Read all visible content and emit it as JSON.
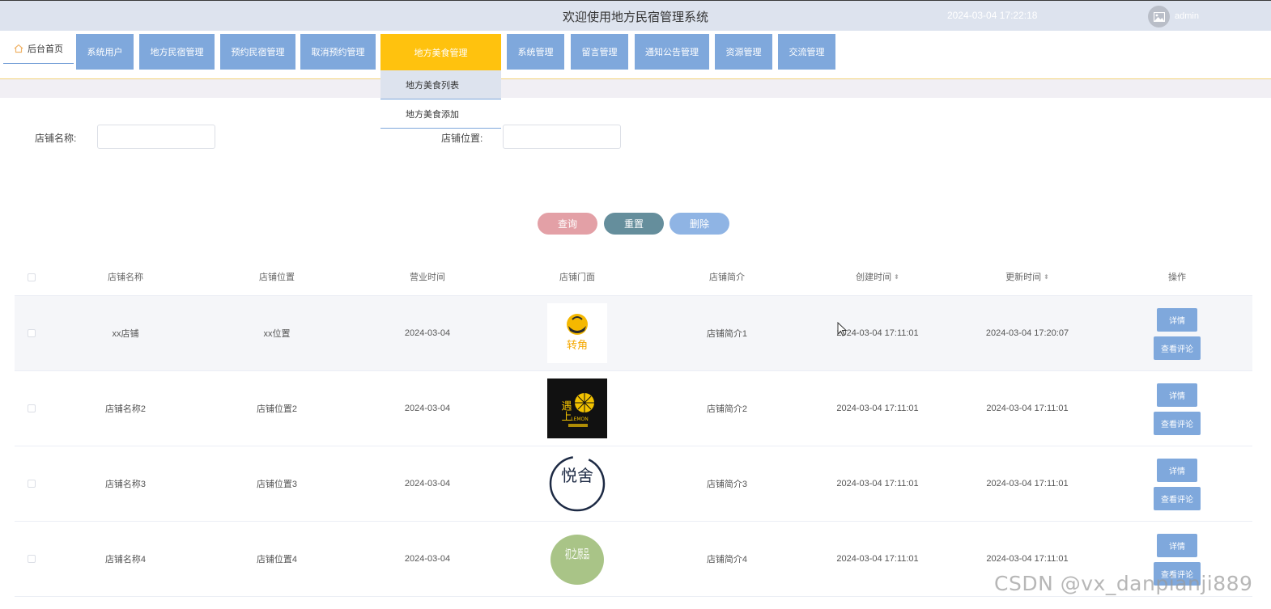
{
  "header": {
    "title": "欢迎使用地方民宿管理系统",
    "datetime": "2024-03-04 17:22:18",
    "username": "admin"
  },
  "nav": {
    "home": "后台首页",
    "items": [
      "系统用户",
      "地方民宿管理",
      "预约民宿管理",
      "取消预约管理",
      "地方美食管理",
      "系统管理",
      "留言管理",
      "通知公告管理",
      "资源管理",
      "交流管理"
    ],
    "active": "地方美食管理",
    "dropdown": [
      "地方美食列表",
      "地方美食添加"
    ]
  },
  "search": {
    "name_label": "店铺名称:",
    "name_value": "",
    "location_label": "店铺位置:",
    "location_value": ""
  },
  "buttons": {
    "query": "查询",
    "reset": "重置",
    "delete": "删除"
  },
  "colors": {
    "nav_blue": "#7fa8dc",
    "nav_active": "#ffc20e",
    "query": "#e3a0a6",
    "reset": "#658e9c",
    "delete": "#8fb4e4"
  },
  "table": {
    "headers": [
      "店铺名称",
      "店铺位置",
      "营业时间",
      "店铺门面",
      "店铺简介",
      "创建时间",
      "更新时间",
      "操作"
    ],
    "rows": [
      {
        "name": "xx店铺",
        "location": "xx位置",
        "hours": "2024-03-04",
        "logo_text": "转角",
        "intro": "店铺简介1",
        "created": "2024-03-04 17:11:01",
        "updated": "2024-03-04 17:20:07"
      },
      {
        "name": "店铺名称2",
        "location": "店铺位置2",
        "hours": "2024-03-04",
        "logo_text": "遇上",
        "logo_sub": "LEMON",
        "intro": "店铺简介2",
        "created": "2024-03-04 17:11:01",
        "updated": "2024-03-04 17:11:01"
      },
      {
        "name": "店铺名称3",
        "location": "店铺位置3",
        "hours": "2024-03-04",
        "logo_text": "悦舍",
        "intro": "店铺简介3",
        "created": "2024-03-04 17:11:01",
        "updated": "2024-03-04 17:11:01"
      },
      {
        "name": "店铺名称4",
        "location": "店铺位置4",
        "hours": "2024-03-04",
        "logo_text": "初之原品",
        "intro": "店铺简介4",
        "created": "2024-03-04 17:11:01",
        "updated": "2024-03-04 17:11:01"
      }
    ],
    "detail_label": "详情",
    "review_label": "查看评论"
  },
  "watermark": "CSDN @vx_danpianji889"
}
